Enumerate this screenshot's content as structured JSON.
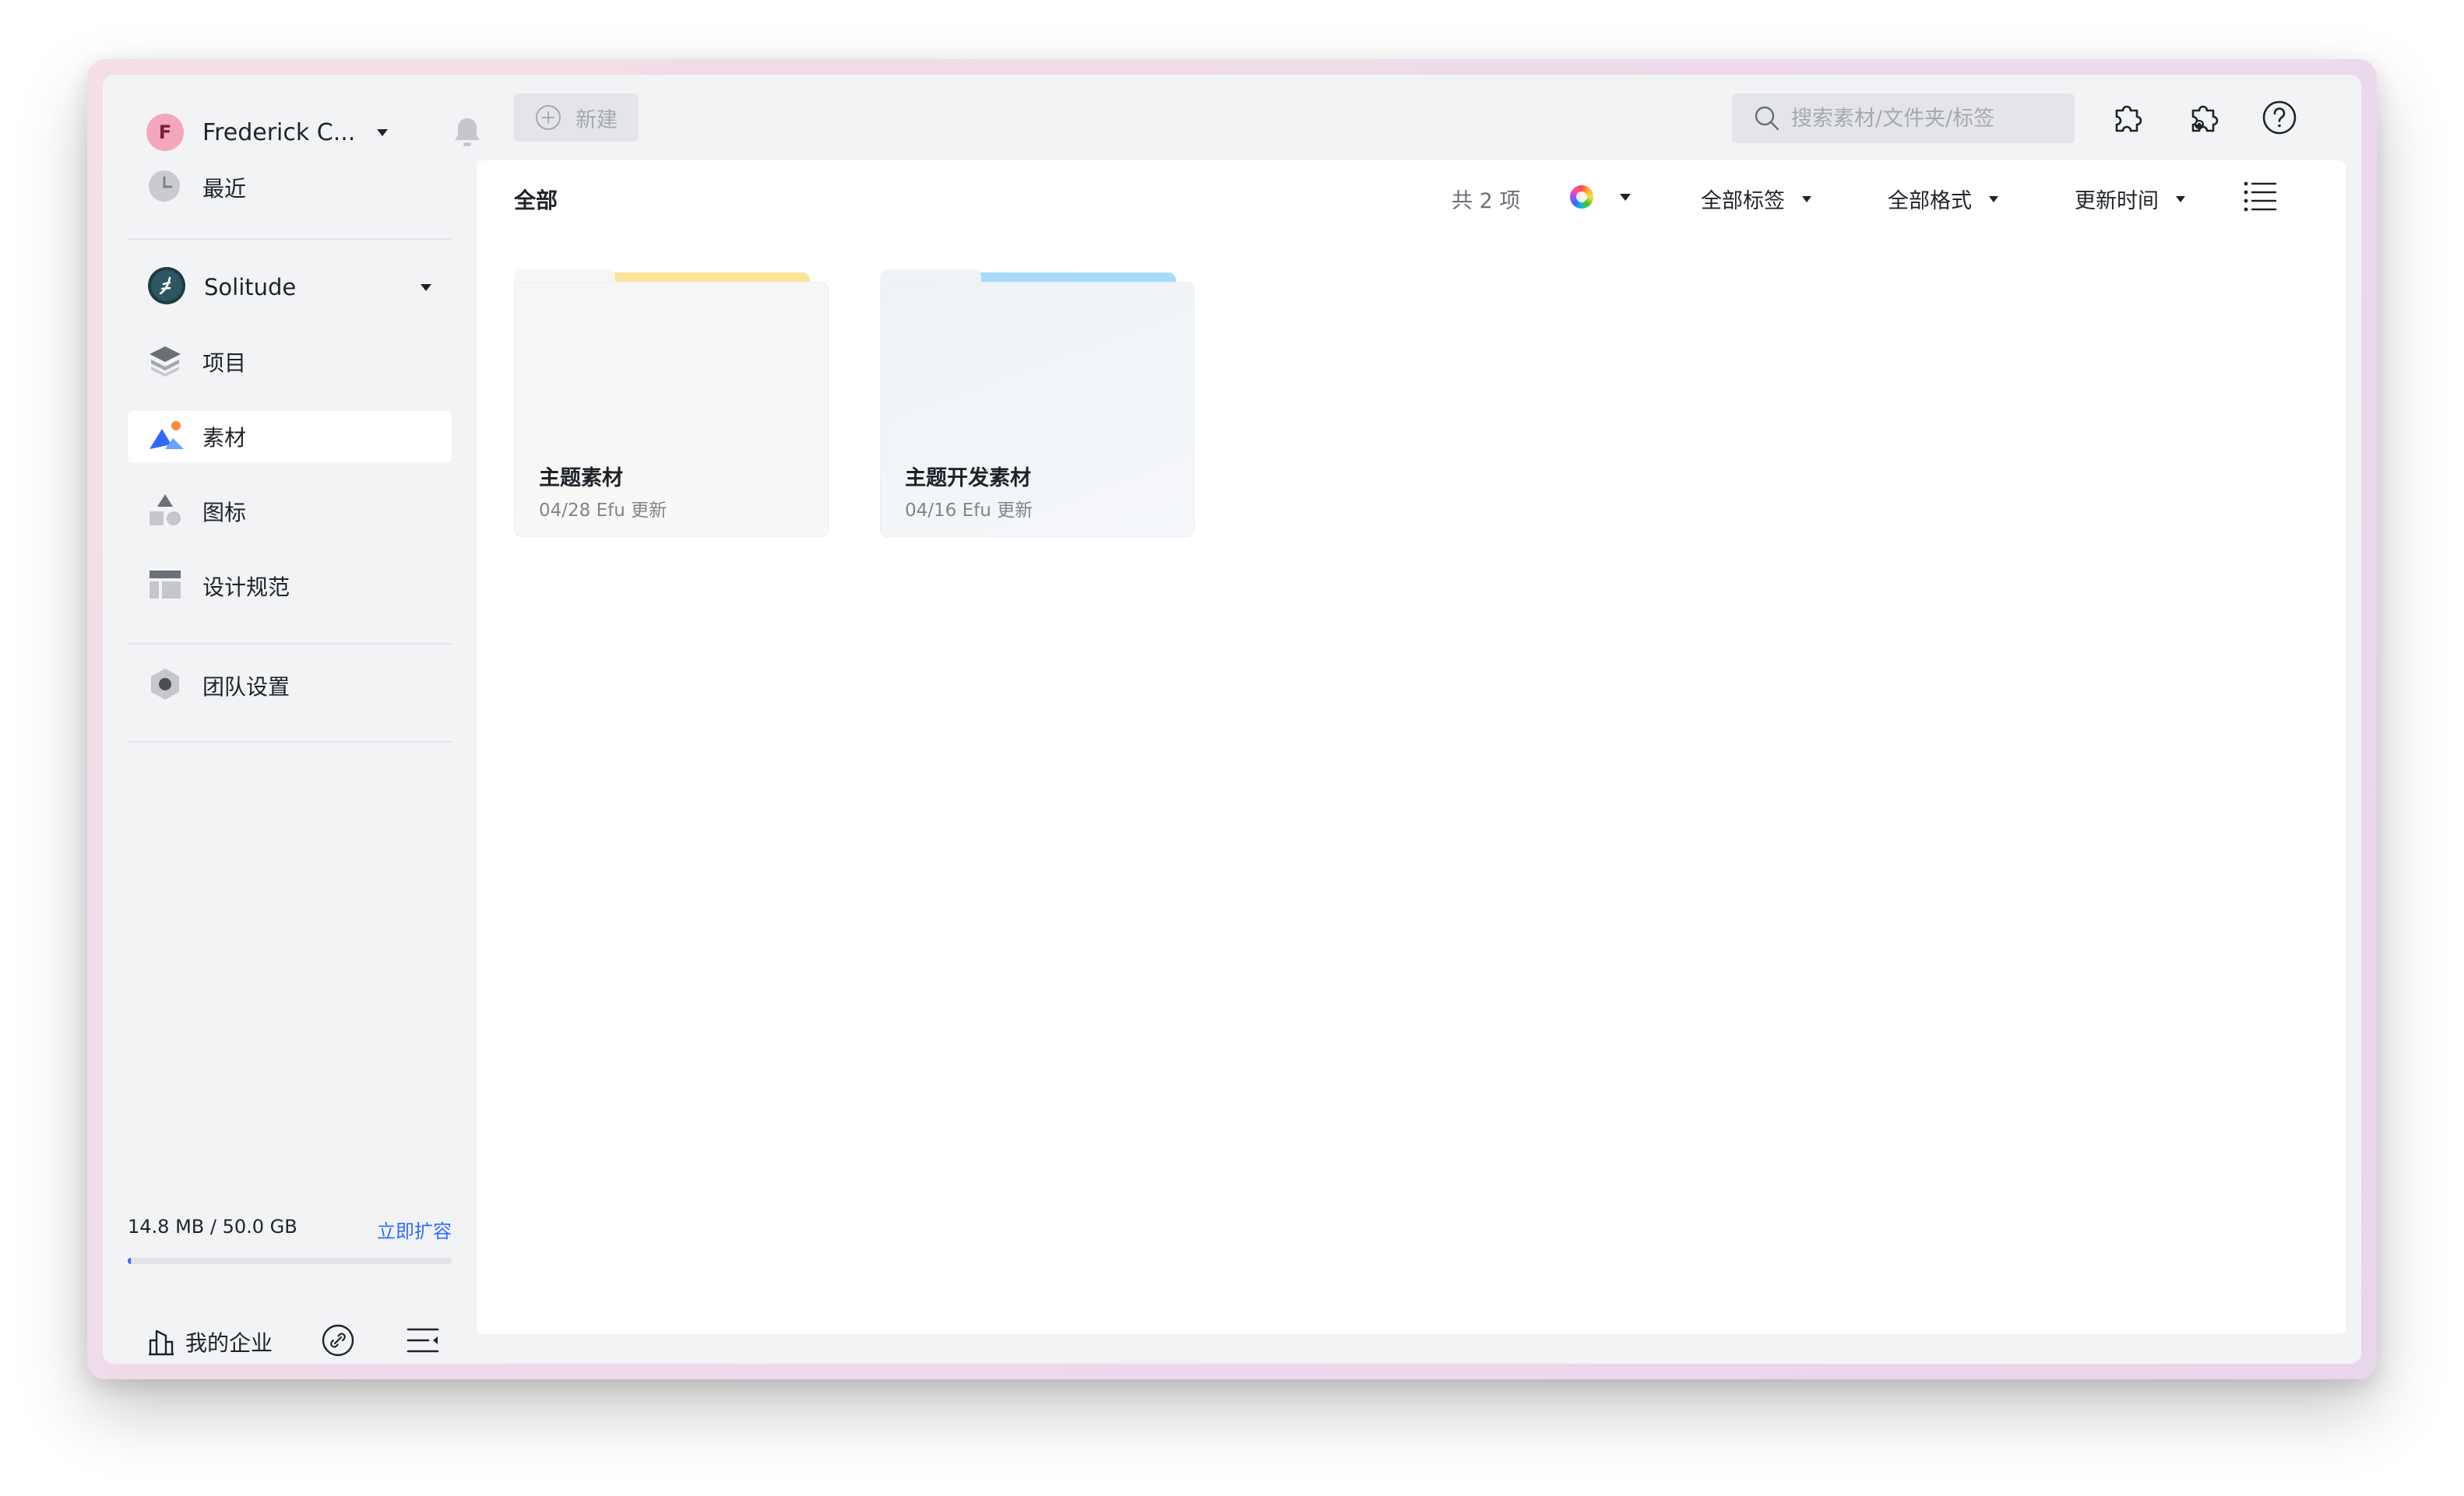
{
  "user": {
    "initial": "F",
    "name": "Frederick C..."
  },
  "sidebar": {
    "recent_label": "最近",
    "team_name": "Solitude",
    "items": [
      {
        "label": "项目",
        "icon": "layers-icon"
      },
      {
        "label": "素材",
        "icon": "mountains-icon",
        "active": true
      },
      {
        "label": "图标",
        "icon": "shapes-icon"
      },
      {
        "label": "设计规范",
        "icon": "layout-icon"
      }
    ],
    "team_settings_label": "团队设置",
    "storage": {
      "used_text": "14.8 MB / 50.0 GB",
      "upgrade_label": "立即扩容",
      "used_fraction": 0.0003
    },
    "enterprise_label": "我的企业"
  },
  "toolbar": {
    "new_label": "新建",
    "search_placeholder": "搜索素材/文件夹/标签"
  },
  "main": {
    "breadcrumb": "全部",
    "count_text": "共 2 项",
    "filters": {
      "tags": "全部标签",
      "formats": "全部格式",
      "sort": "更新时间"
    }
  },
  "folders": [
    {
      "name": "主题素材",
      "meta": "04/28 Efu 更新",
      "accent": "#fbe49a"
    },
    {
      "name": "主题开发素材",
      "meta": "04/16 Efu 更新",
      "accent": "#a6dcfa"
    }
  ],
  "colors": {
    "accent": "#2f6bff",
    "sidebar_bg": "#f2f3f5",
    "avatar_bg": "#f4a6bd"
  }
}
